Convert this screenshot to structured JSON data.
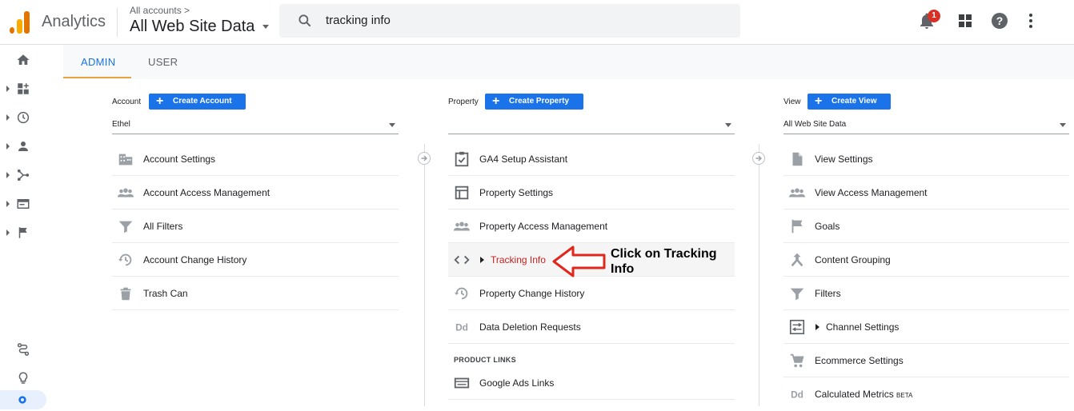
{
  "topbar": {
    "app_name": "Analytics",
    "breadcrumb_small": "All accounts >",
    "breadcrumb_big": "All Web Site Data",
    "search_value": "tracking info",
    "notification_count": "1"
  },
  "sidebar": {
    "icons": [
      "home-icon",
      "dashboards-icon",
      "realtime-icon",
      "audience-icon",
      "acquisition-icon",
      "behavior-icon",
      "conversions-icon",
      "attribution-icon",
      "discover-icon",
      "admin-gear-icon"
    ]
  },
  "tabs": {
    "admin": "ADMIN",
    "user": "USER"
  },
  "account": {
    "label": "Account",
    "create": "Create Account",
    "selected": "Ethel",
    "items": [
      "Account Settings",
      "Account Access Management",
      "All Filters",
      "Account Change History",
      "Trash Can"
    ]
  },
  "property": {
    "label": "Property",
    "create": "Create Property",
    "selected": "",
    "items": [
      "GA4 Setup Assistant",
      "Property Settings",
      "Property Access Management",
      "Tracking Info",
      "Property Change History",
      "Data Deletion Requests"
    ],
    "product_links_header": "PRODUCT LINKS",
    "product_links": [
      "Google Ads Links"
    ]
  },
  "view": {
    "label": "View",
    "create": "Create View",
    "selected": "All Web Site Data",
    "items": [
      "View Settings",
      "View Access Management",
      "Goals",
      "Content Grouping",
      "Filters",
      "Channel Settings",
      "Ecommerce Settings",
      "Calculated Metrics"
    ],
    "beta": "BETA"
  },
  "annotation": {
    "line1": "Click on Tracking",
    "line2": "Info"
  },
  "colors": {
    "accent": "#1a73e8",
    "highlight_text": "#c5221f",
    "arrow": "#e1261c",
    "tab_underline": "#e8a341"
  }
}
